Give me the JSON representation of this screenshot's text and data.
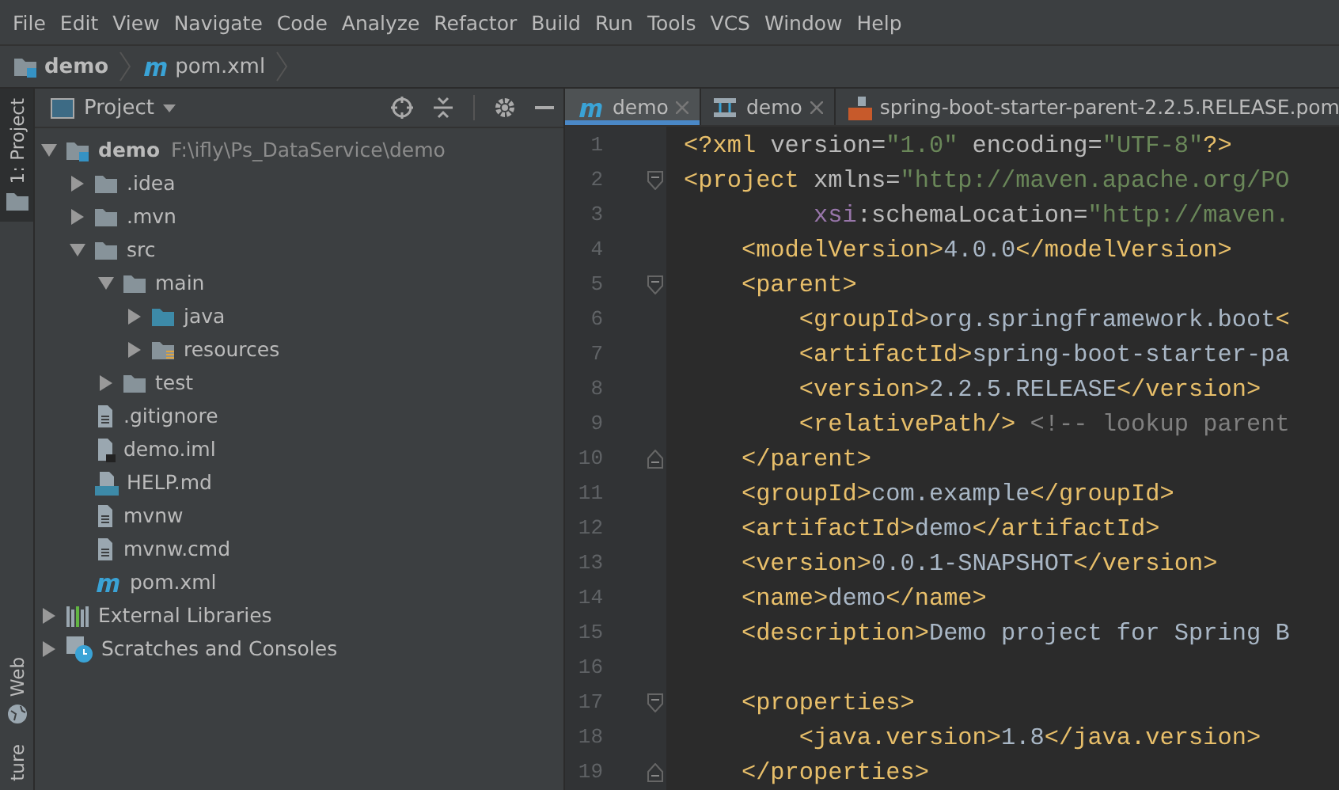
{
  "menu": [
    "File",
    "Edit",
    "View",
    "Navigate",
    "Code",
    "Analyze",
    "Refactor",
    "Build",
    "Run",
    "Tools",
    "VCS",
    "Window",
    "Help"
  ],
  "breadcrumb": [
    {
      "label": "demo",
      "kind": "module"
    },
    {
      "label": "pom.xml",
      "kind": "maven"
    }
  ],
  "side_tabs": [
    {
      "label": "1: Project",
      "selected": true,
      "kind": "folder"
    },
    {
      "label": "Web",
      "selected": false,
      "kind": "globe"
    },
    {
      "label": "ture",
      "selected": false,
      "kind": "plain"
    }
  ],
  "project_panel": {
    "title": "Project"
  },
  "tree": [
    {
      "label": "demo",
      "path": "F:\\ifly\\Ps_DataService\\demo",
      "kind": "module",
      "expanded": true,
      "children": [
        {
          "label": ".idea",
          "kind": "folder",
          "expanded": false
        },
        {
          "label": ".mvn",
          "kind": "folder",
          "expanded": false
        },
        {
          "label": "src",
          "kind": "folder",
          "expanded": true,
          "children": [
            {
              "label": "main",
              "kind": "folder",
              "expanded": true,
              "children": [
                {
                  "label": "java",
                  "kind": "source",
                  "expanded": false
                },
                {
                  "label": "resources",
                  "kind": "resources",
                  "expanded": false
                }
              ]
            },
            {
              "label": "test",
              "kind": "folder",
              "expanded": false
            }
          ]
        },
        {
          "label": ".gitignore",
          "kind": "file"
        },
        {
          "label": "demo.iml",
          "kind": "iml"
        },
        {
          "label": "HELP.md",
          "kind": "markdown"
        },
        {
          "label": "mvnw",
          "kind": "file"
        },
        {
          "label": "mvnw.cmd",
          "kind": "file"
        },
        {
          "label": "pom.xml",
          "kind": "maven"
        }
      ]
    },
    {
      "label": "External Libraries",
      "kind": "libraries",
      "expanded": false
    },
    {
      "label": "Scratches and Consoles",
      "kind": "scratches",
      "expanded": false
    }
  ],
  "editor_tabs": [
    {
      "label": "demo",
      "kind": "maven",
      "selected": true
    },
    {
      "label": "demo",
      "kind": "diagram",
      "selected": false
    },
    {
      "label": "spring-boot-starter-parent-2.2.5.RELEASE.pom",
      "kind": "pom",
      "selected": false
    }
  ],
  "code_lines": [
    {
      "num": "1",
      "tokens": [
        {
          "kind": "tag",
          "text": "<?xml "
        },
        {
          "kind": "attr",
          "text": "version="
        },
        {
          "kind": "string",
          "text": "\"1.0\" "
        },
        {
          "kind": "attr",
          "text": "encoding="
        },
        {
          "kind": "string",
          "text": "\"UTF-8\""
        },
        {
          "kind": "tag",
          "text": "?>"
        }
      ]
    },
    {
      "num": "2",
      "fold_open": true,
      "tokens": [
        {
          "kind": "tag",
          "text": "<project "
        },
        {
          "kind": "attr",
          "text": "xmlns="
        },
        {
          "kind": "string",
          "text": "\"http://maven.apache.org/PO"
        }
      ]
    },
    {
      "num": "3",
      "tokens": [
        {
          "kind": "ns",
          "text": "         xsi"
        },
        {
          "kind": "attr",
          "text": ":schemaLocation="
        },
        {
          "kind": "string",
          "text": "\"http://maven."
        }
      ]
    },
    {
      "num": "4",
      "tokens": [
        {
          "kind": "tag",
          "text": "    <modelVersion>"
        },
        {
          "kind": "text",
          "text": "4.0.0"
        },
        {
          "kind": "tag",
          "text": "</modelVersion>"
        }
      ]
    },
    {
      "num": "5",
      "fold_open": true,
      "tokens": [
        {
          "kind": "tag",
          "text": "    <parent>"
        }
      ]
    },
    {
      "num": "6",
      "tokens": [
        {
          "kind": "tag",
          "text": "        <groupId>"
        },
        {
          "kind": "text",
          "text": "org.springframework.boot"
        },
        {
          "kind": "tag",
          "text": "<"
        }
      ]
    },
    {
      "num": "7",
      "tokens": [
        {
          "kind": "tag",
          "text": "        <artifactId>"
        },
        {
          "kind": "text",
          "text": "spring-boot-starter-pa"
        }
      ]
    },
    {
      "num": "8",
      "tokens": [
        {
          "kind": "tag",
          "text": "        <version>"
        },
        {
          "kind": "text",
          "text": "2.2.5.RELEASE"
        },
        {
          "kind": "tag",
          "text": "</version>"
        }
      ]
    },
    {
      "num": "9",
      "tokens": [
        {
          "kind": "tag",
          "text": "        <relativePath/> "
        },
        {
          "kind": "comment",
          "text": "<!-- lookup parent"
        }
      ]
    },
    {
      "num": "10",
      "fold_close": true,
      "tokens": [
        {
          "kind": "tag",
          "text": "    </parent>"
        }
      ]
    },
    {
      "num": "11",
      "tokens": [
        {
          "kind": "tag",
          "text": "    <groupId>"
        },
        {
          "kind": "text",
          "text": "com.example"
        },
        {
          "kind": "tag",
          "text": "</groupId>"
        }
      ]
    },
    {
      "num": "12",
      "tokens": [
        {
          "kind": "tag",
          "text": "    <artifactId>"
        },
        {
          "kind": "text",
          "text": "demo"
        },
        {
          "kind": "tag",
          "text": "</artifactId>"
        }
      ]
    },
    {
      "num": "13",
      "tokens": [
        {
          "kind": "tag",
          "text": "    <version>"
        },
        {
          "kind": "text",
          "text": "0.0.1-SNAPSHOT"
        },
        {
          "kind": "tag",
          "text": "</version>"
        }
      ]
    },
    {
      "num": "14",
      "tokens": [
        {
          "kind": "tag",
          "text": "    <name>"
        },
        {
          "kind": "text",
          "text": "demo"
        },
        {
          "kind": "tag",
          "text": "</name>"
        }
      ]
    },
    {
      "num": "15",
      "tokens": [
        {
          "kind": "tag",
          "text": "    <description>"
        },
        {
          "kind": "text",
          "text": "Demo project for Spring B"
        }
      ]
    },
    {
      "num": "16"
    },
    {
      "num": "17",
      "fold_open": true,
      "tokens": [
        {
          "kind": "tag",
          "text": "    <properties>"
        }
      ]
    },
    {
      "num": "18",
      "tokens": [
        {
          "kind": "tag",
          "text": "        <java.version>"
        },
        {
          "kind": "text",
          "text": "1.8"
        },
        {
          "kind": "tag",
          "text": "</java.version>"
        }
      ]
    },
    {
      "num": "19",
      "fold_close": true,
      "tokens": [
        {
          "kind": "tag",
          "text": "    </properties>"
        }
      ]
    }
  ]
}
